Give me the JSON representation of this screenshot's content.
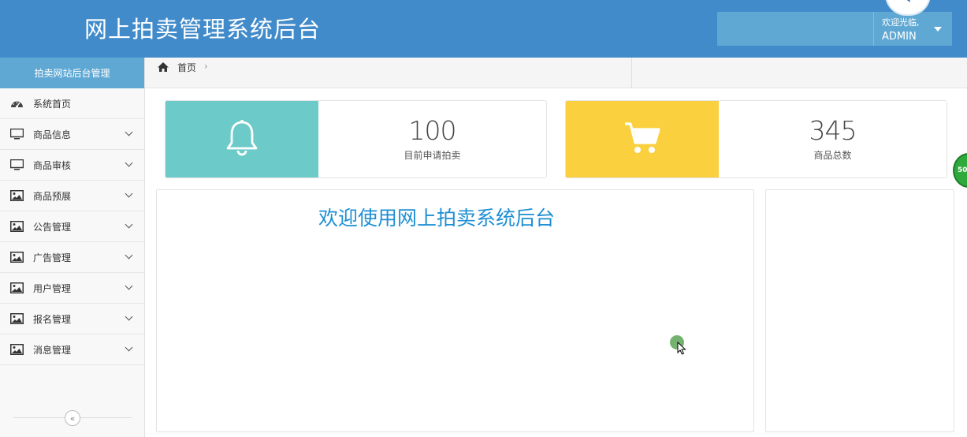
{
  "header": {
    "title": "网上拍卖管理系统后台",
    "welcome": "欢迎光临,",
    "user": "ADMIN"
  },
  "sidebar": {
    "title": "拍卖网站后台管理",
    "items": [
      {
        "label": "系统首页",
        "icon": "dashboard-icon",
        "expandable": false
      },
      {
        "label": "商品信息",
        "icon": "monitor-icon",
        "expandable": true
      },
      {
        "label": "商品审核",
        "icon": "monitor-icon",
        "expandable": true
      },
      {
        "label": "商品预展",
        "icon": "image-icon",
        "expandable": true
      },
      {
        "label": "公告管理",
        "icon": "image-icon",
        "expandable": true
      },
      {
        "label": "广告管理",
        "icon": "image-icon",
        "expandable": true
      },
      {
        "label": "用户管理",
        "icon": "image-icon",
        "expandable": true
      },
      {
        "label": "报名管理",
        "icon": "image-icon",
        "expandable": true
      },
      {
        "label": "消息管理",
        "icon": "image-icon",
        "expandable": true
      }
    ],
    "collapse": "«"
  },
  "breadcrumb": {
    "home": "首页",
    "separator": "›"
  },
  "stats": [
    {
      "value": "100",
      "label": "目前申请拍卖",
      "icon": "bell-icon",
      "color": "#6ccac9"
    },
    {
      "value": "345",
      "label": "商品总数",
      "icon": "cart-icon",
      "color": "#fad03f"
    }
  ],
  "main": {
    "welcome": "欢迎使用网上拍卖系统后台"
  },
  "badge": "50",
  "colors": {
    "primary": "#428bca",
    "accent": "#5fa8d3",
    "teal": "#6ccac9",
    "yellow": "#fad03f",
    "welcome_text": "#1e8fd4"
  }
}
